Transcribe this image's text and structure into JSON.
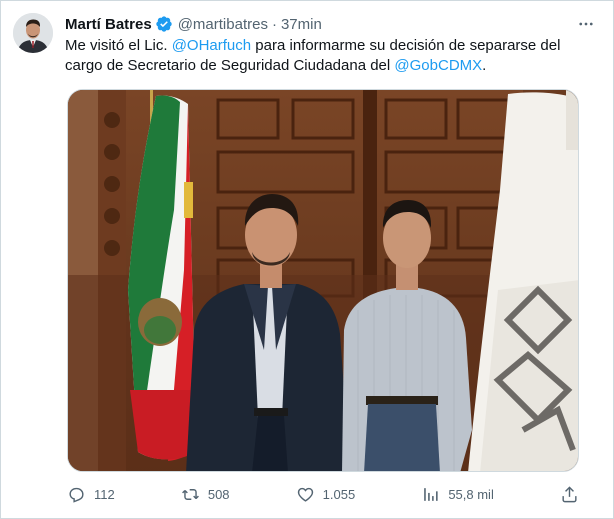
{
  "tweet": {
    "author_name": "Martí Batres",
    "handle": "@martibatres",
    "separator": "·",
    "time": "37min",
    "text_part1": "Me visitó el Lic. ",
    "mention1": "@OHarfuch",
    "text_part2": " para informarme su decisión de separarse del cargo de Secretario de Seguridad Ciudadana del ",
    "mention2": "@GobCDMX",
    "text_part3": "."
  },
  "actions": {
    "replies": "112",
    "retweets": "508",
    "likes": "1.055",
    "views": "55,8 mil"
  },
  "icons": {
    "verified": "verified-badge-icon",
    "more": "more-options-icon",
    "reply": "reply-icon",
    "retweet": "retweet-icon",
    "like": "heart-icon",
    "views": "views-chart-icon",
    "share": "share-icon"
  },
  "colors": {
    "accent": "#1d9bf0",
    "secondary_text": "#536471",
    "border": "#cfd9de"
  }
}
